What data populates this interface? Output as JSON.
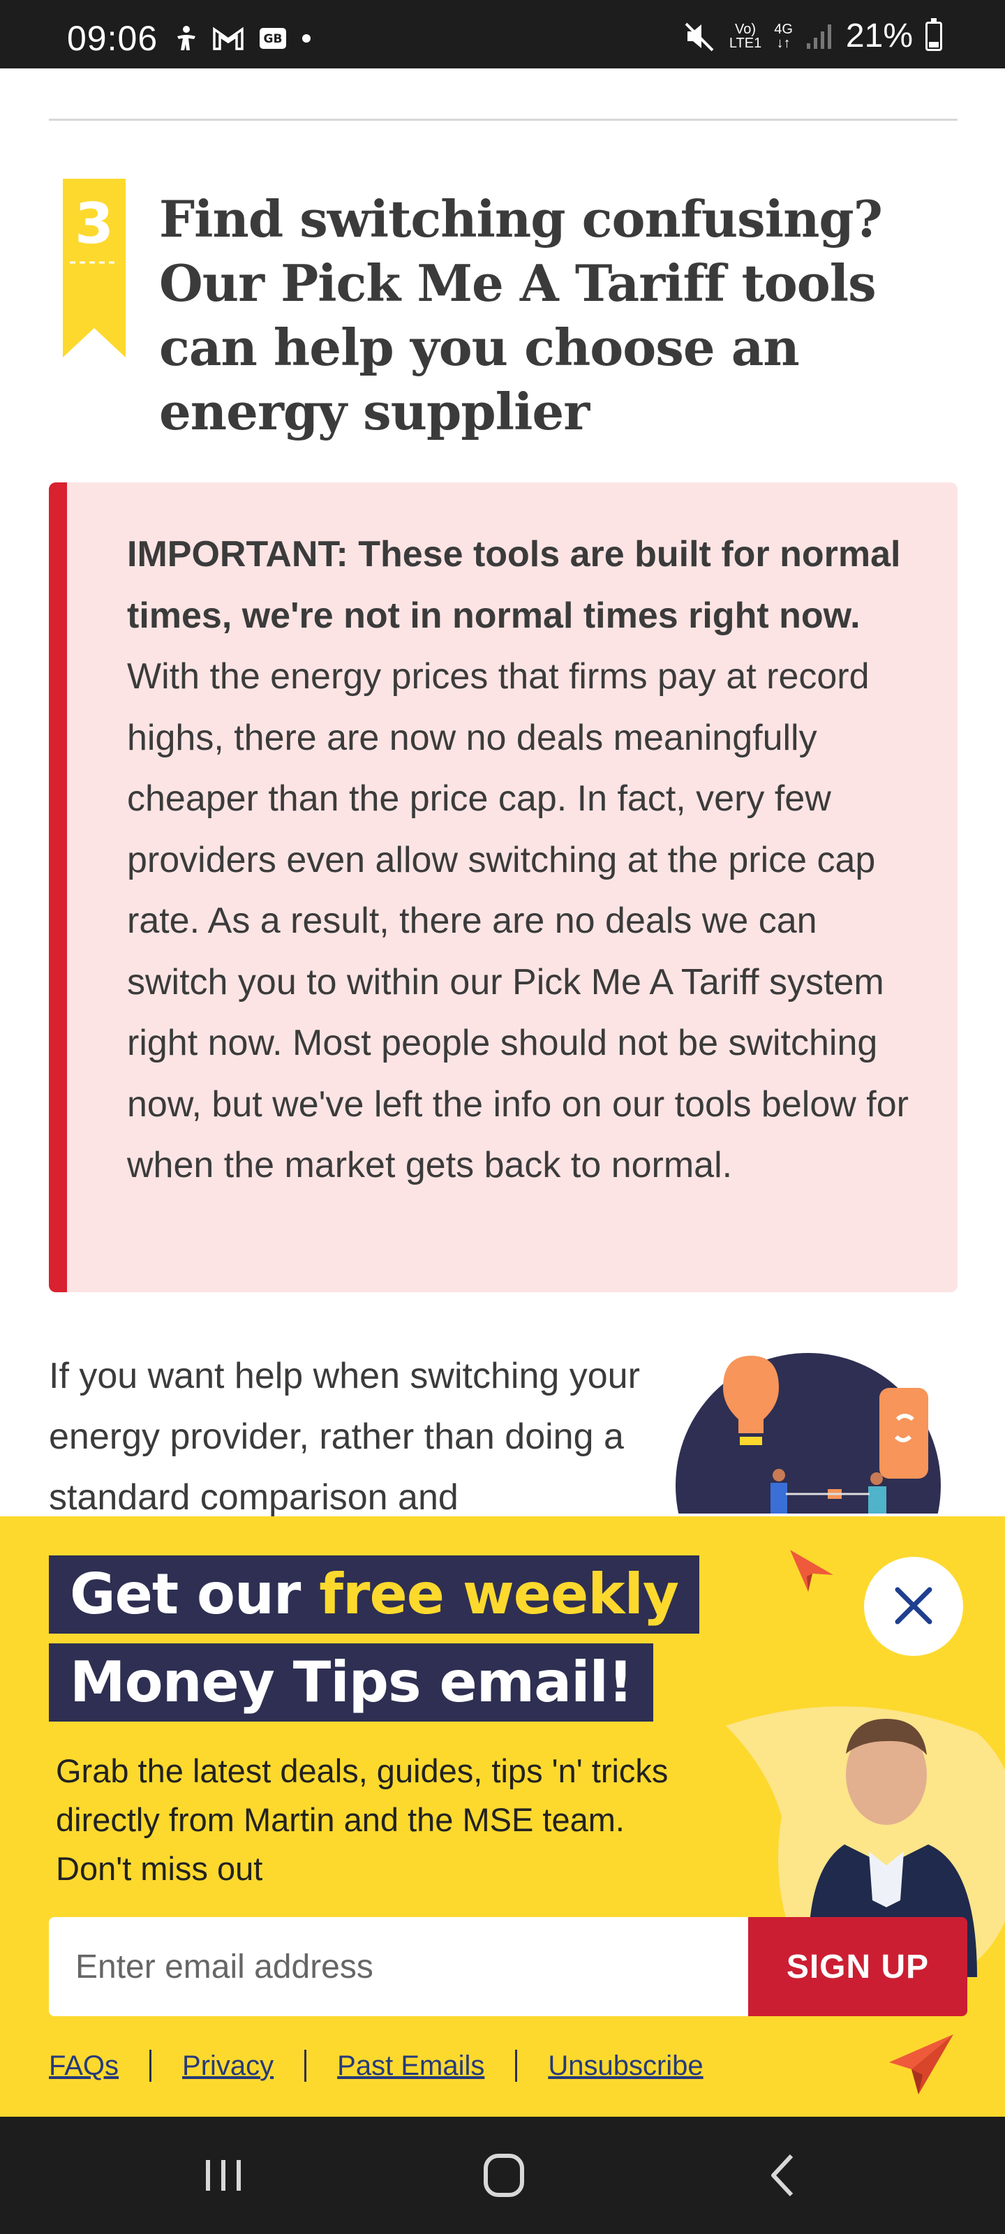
{
  "status_bar": {
    "time": "09:06",
    "network_top": "Vo)",
    "network_bottom": "LTE1",
    "signal_type": "4G",
    "battery_percent": "21%",
    "battery_level": 0.21,
    "icons": [
      "accessibility-icon",
      "gmail-icon",
      "news-icon",
      "dot-icon",
      "mute-icon",
      "signal-icon",
      "battery-icon"
    ]
  },
  "section": {
    "badge_number": "3",
    "heading": "Find switching confusing? Our Pick Me A Tariff tools can help you choose an energy supplier"
  },
  "alert": {
    "bold_text": "IMPORTANT: These tools are built for normal times, we're not in normal times right now.",
    "body_text": " With the energy prices that firms pay at record highs, there are now no deals meaningfully cheaper than the price cap. In fact, very few providers even allow switching at the price cap rate. As a result, there are no deals we can switch you to within our Pick Me A Tariff system right now. Most people should not be switching now, but we've left the info on our tools below for when the market gets back to normal.",
    "accent_color": "#d9212f",
    "background": "#fde4e4"
  },
  "intro": {
    "text": "If you want help when switching your energy provider, rather than doing a standard comparison and"
  },
  "newsletter": {
    "title_part1": "Get our ",
    "title_highlight": "free weekly",
    "title_line2": "Money Tips email!",
    "description": "Grab the latest deals, guides, tips 'n' tricks directly from Martin and the MSE team. Don't miss out",
    "email_placeholder": "Enter email address",
    "signup_label": "SIGN UP",
    "links": [
      "FAQs",
      "Privacy",
      "Past Emails",
      "Unsubscribe"
    ],
    "background": "#fdd92e",
    "pill_color": "#2e2f52",
    "button_color": "#cc1e32"
  }
}
